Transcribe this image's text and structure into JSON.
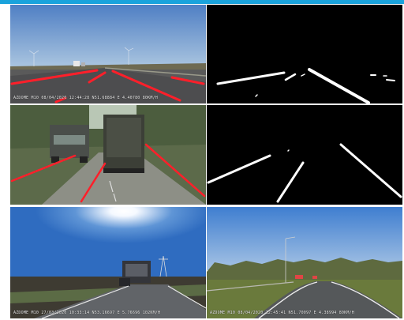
{
  "panels": {
    "highway_original": {
      "overlay": "AZDOME M10 08/04/2020 12:44:28 N51.68884 E 4.40780  80KM/H",
      "sky_color": "#6f9ad2",
      "lane_marking_color": "#ff1f2a"
    },
    "highway_mask": {
      "background": "#000000",
      "lane_color": "#ffffff"
    },
    "trucks_original": {
      "lane_marking_color": "#ff1f2a"
    },
    "trucks_mask": {
      "background": "#000000",
      "lane_color": "#ffffff"
    },
    "sun_road": {
      "overlay": "AZDOME M10 27/03/2020 10:33:14 N53.16697 E 5.76696 102KM/H"
    },
    "curve_road": {
      "overlay": "AZDOME M10 08/04/2020 12:45:41 N51.70097 E 4.38994  80KM/H"
    }
  }
}
